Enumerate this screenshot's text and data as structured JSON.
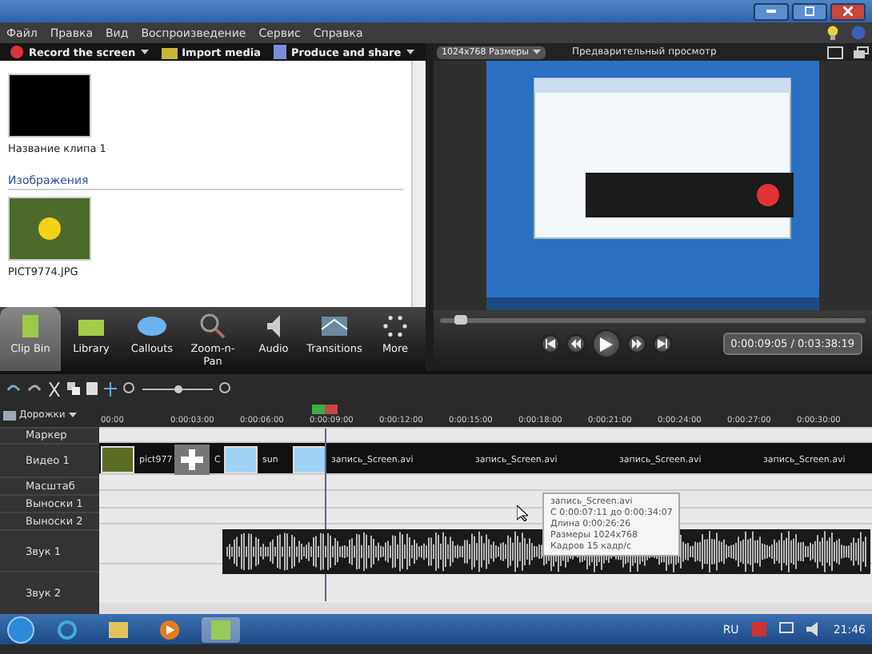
{
  "menu": [
    "Файл",
    "Правка",
    "Вид",
    "Воспроизведение",
    "Сервис",
    "Справка"
  ],
  "toolbar": [
    {
      "label": "Record the screen",
      "kind": "record",
      "dropdown": true
    },
    {
      "label": "Import media",
      "kind": "import",
      "dropdown": false
    },
    {
      "label": "Produce and share",
      "kind": "produce",
      "dropdown": true
    }
  ],
  "clip_bin": {
    "items": [
      {
        "kind": "clip",
        "label": "Название клипа 1"
      },
      {
        "kind": "section",
        "label": "Изображения"
      },
      {
        "kind": "image",
        "label": "PICT9774.JPG"
      }
    ]
  },
  "tasks": [
    {
      "label": "Clip Bin",
      "kind": "clipbin",
      "selected": true
    },
    {
      "label": "Library",
      "kind": "library",
      "selected": false
    },
    {
      "label": "Callouts",
      "kind": "callouts",
      "selected": false
    },
    {
      "label": "Zoom-n-Pan",
      "kind": "zoom",
      "selected": false
    },
    {
      "label": "Audio",
      "kind": "audio",
      "selected": false
    },
    {
      "label": "Transitions",
      "kind": "transitions",
      "selected": false
    },
    {
      "label": "More",
      "kind": "more",
      "selected": false
    }
  ],
  "preview": {
    "size": "1024x768 Размеры",
    "title": "Предварительный просмотр",
    "time": "0:00:09:05 / 0:03:38:19",
    "level": 0.05
  },
  "zoom": {
    "level": 0.5
  },
  "timeline": {
    "tracks_menu": "Дорожки",
    "ruler": [
      "00:00",
      "0:00:03:00",
      "0:00:06:00",
      "0:00:09:00",
      "0:00:12:00",
      "0:00:15:00",
      "0:00:18:00",
      "0:00:21:00",
      "0:00:24:00",
      "0:00:27:00",
      "0:00:30:00"
    ],
    "tracks": [
      {
        "name": "Маркер",
        "kind": "marker"
      },
      {
        "name": "Видео 1",
        "kind": "video"
      },
      {
        "name": "Масштаб",
        "kind": "thin"
      },
      {
        "name": "Выноски 1",
        "kind": "thin"
      },
      {
        "name": "Выноски 2",
        "kind": "thin"
      },
      {
        "name": "Звук 1",
        "kind": "audio"
      },
      {
        "name": "Звук 2",
        "kind": "audio"
      }
    ],
    "video_clips": [
      {
        "kind": "image",
        "label": "pict977"
      },
      {
        "kind": "transition"
      },
      {
        "kind": "text",
        "label": "C"
      },
      {
        "kind": "screen",
        "label": "sun"
      },
      {
        "kind": "screen",
        "label": "запись_Screen.avi"
      },
      {
        "kind": "text",
        "label": "запись_Screen.avi"
      },
      {
        "kind": "text",
        "label": "запись_Screen.avi"
      },
      {
        "kind": "text",
        "label": "запись_Screen.avi"
      }
    ],
    "tooltip": [
      "запись_Screen.avi",
      "С 0:00:07:11 до 0:00:34:07",
      "Длина 0:00:26:26",
      "Размеры 1024x768",
      "Кадров 15 кадр/с"
    ]
  },
  "taskbar": {
    "language": "RU",
    "clock": "21:46"
  }
}
